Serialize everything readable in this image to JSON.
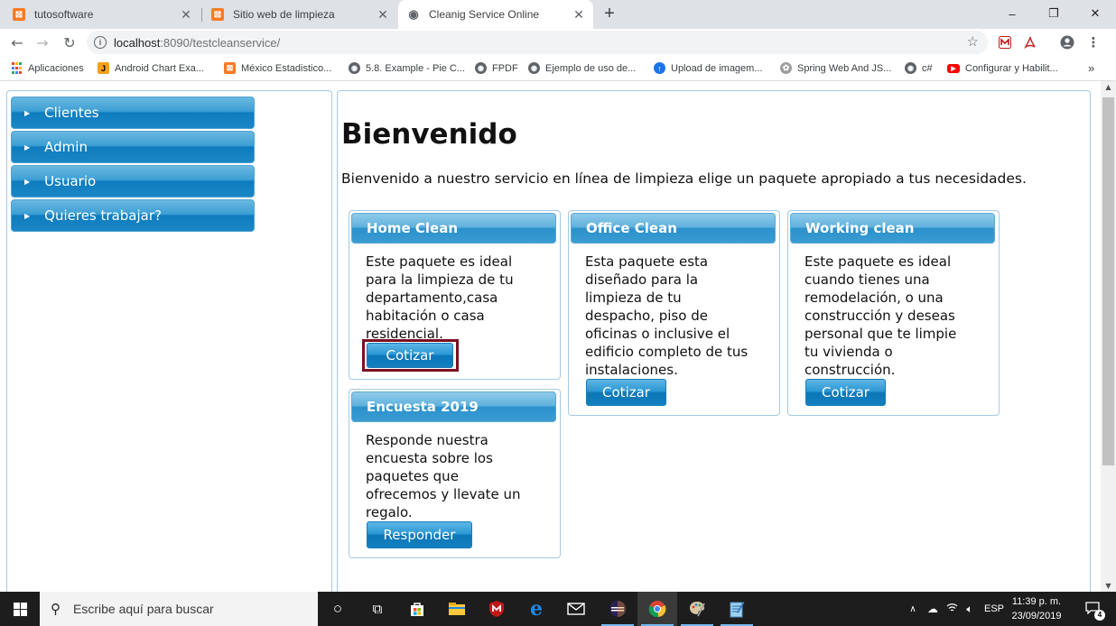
{
  "browser": {
    "tabs": [
      {
        "title": "tutosoftware",
        "favicon": "xampp-icon"
      },
      {
        "title": "Sitio web de limpieza",
        "favicon": "xampp-icon"
      },
      {
        "title": "Cleanig Service Online",
        "favicon": "globe-icon"
      }
    ],
    "new_tab": "+",
    "window_controls": {
      "minimize": "–",
      "maximize": "❐",
      "close": "✕"
    },
    "url_host": "localhost",
    "url_rest": ":8090/testcleanservice/",
    "bookmarks": [
      "Aplicaciones",
      "Android Chart Exa...",
      "México Estadistico...",
      "5.8. Example - Pie C...",
      "FPDF",
      "Ejemplo de uso de...",
      "Upload de imagem...",
      "Spring Web And JS...",
      "c#",
      "Configurar y Habilit..."
    ],
    "bookmarks_overflow": "»"
  },
  "sidebar": {
    "items": [
      {
        "label": "Clientes"
      },
      {
        "label": "Admin"
      },
      {
        "label": "Usuario"
      },
      {
        "label": "Quieres trabajar?"
      }
    ]
  },
  "main": {
    "title": "Bienvenido",
    "intro": "Bienvenido a nuestro servicio en línea de limpieza elige un paquete apropiado a tus necesidades.",
    "cards": [
      {
        "title": "Home Clean",
        "lines": [
          "Este paquete es ideal",
          "para la limpieza de tu",
          "departamento,casa",
          "habitación o casa",
          "residencial."
        ],
        "button": "Cotizar"
      },
      {
        "title": "Office Clean",
        "lines": [
          "Esta paquete esta",
          "diseñado para la",
          "limpieza de tu",
          "despacho, piso de",
          "oficinas o inclusive el",
          "edificio completo de tus",
          "instalaciones."
        ],
        "button": "Cotizar"
      },
      {
        "title": "Working clean",
        "lines": [
          "Este paquete es ideal",
          "cuando tienes una",
          "remodelación, o una",
          "construcción y deseas",
          "personal que te limpie",
          "tu vivienda o",
          "construcción."
        ],
        "button": "Cotizar"
      },
      {
        "title": "Encuesta 2019",
        "lines": [
          "Responde nuestra",
          "encuesta sobre los",
          "paquetes que",
          "ofrecemos y llevate un",
          "regalo."
        ],
        "button": "Responder"
      }
    ]
  },
  "taskbar": {
    "search_placeholder": "Escribe aquí para buscar",
    "language": "ESP",
    "time": "11:39 p. m.",
    "date": "23/09/2019",
    "notifications_count": "4"
  },
  "colors": {
    "accent_blue": "#0e7cbf",
    "focus_ring": "#7b1021",
    "border_blue": "#a6c9e2"
  }
}
